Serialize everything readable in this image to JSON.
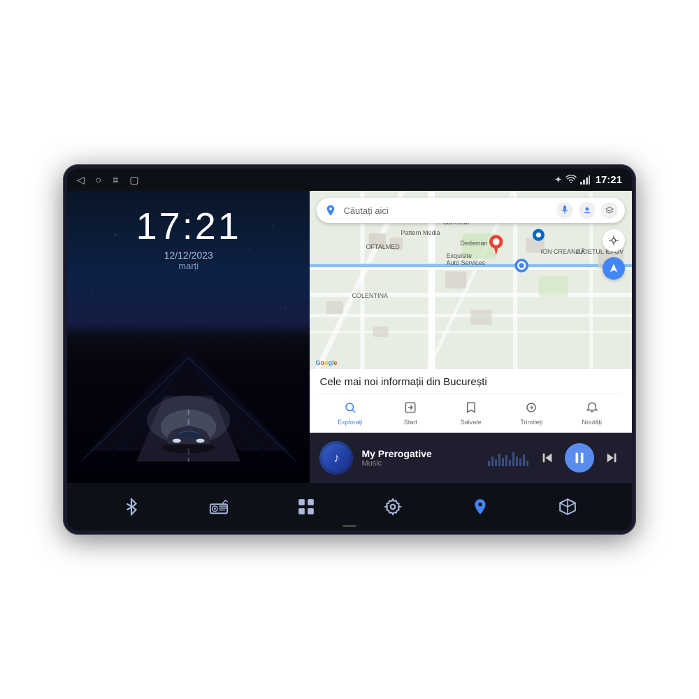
{
  "device": {
    "status_bar": {
      "back_icon": "◁",
      "home_icon": "○",
      "menu_icon": "≡",
      "screenshot_icon": "▢",
      "bluetooth_icon": "✦",
      "wifi_icon": "WiFi",
      "time": "17:21",
      "signal_icon": "📶"
    },
    "left_panel": {
      "time": "17:21",
      "date": "12/12/2023",
      "day": "marți"
    },
    "map": {
      "search_placeholder": "Căutați aici",
      "info_title": "Cele mai noi informații din București",
      "nav_buttons": [
        {
          "label": "Explorați",
          "icon": "🔍"
        },
        {
          "label": "Start",
          "icon": "🚗"
        },
        {
          "label": "Salvate",
          "icon": "🔖"
        },
        {
          "label": "Trimiteți",
          "icon": "↗"
        },
        {
          "label": "Noutăți",
          "icon": "🔔"
        }
      ]
    },
    "music": {
      "title": "My Prerogative",
      "subtitle": "Music",
      "prev_icon": "⏮",
      "play_icon": "⏸",
      "next_icon": "⏭"
    },
    "dock": {
      "items": [
        {
          "name": "bluetooth",
          "icon": "bluetooth"
        },
        {
          "name": "radio",
          "icon": "radio"
        },
        {
          "name": "apps",
          "icon": "apps"
        },
        {
          "name": "settings",
          "icon": "settings"
        },
        {
          "name": "maps",
          "icon": "maps"
        },
        {
          "name": "cube",
          "icon": "cube"
        }
      ]
    }
  }
}
